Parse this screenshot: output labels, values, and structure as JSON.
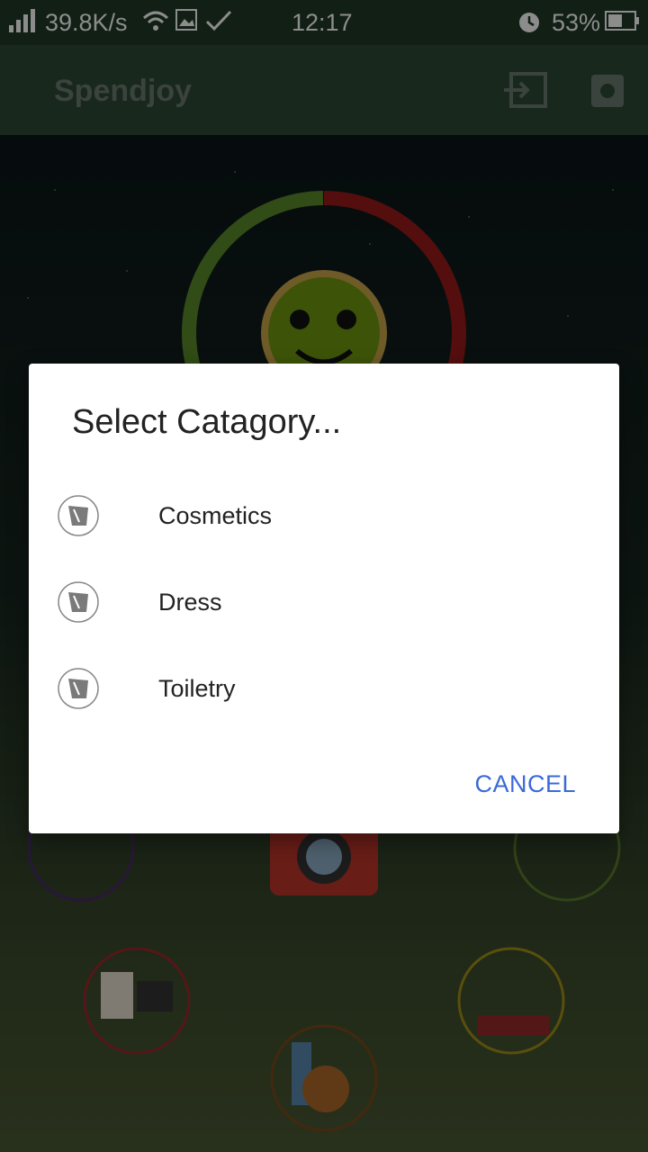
{
  "status_bar": {
    "speed": "39.8K/s",
    "time": "12:17",
    "battery": "53%"
  },
  "app_bar": {
    "title": "Spendjoy",
    "icons": [
      "login-icon",
      "gear-icon"
    ]
  },
  "dialog": {
    "title": "Select Catagory...",
    "items": [
      {
        "label": "Cosmetics",
        "icon": "category-icon"
      },
      {
        "label": "Dress",
        "icon": "category-icon"
      },
      {
        "label": "Toiletry",
        "icon": "category-icon"
      }
    ],
    "cancel_label": "CANCEL"
  },
  "colors": {
    "accent": "#3a6ad8",
    "appbar": "#2f4a36",
    "statusbar": "#1f3a27",
    "gauge_green": "#5a8a2a",
    "gauge_red": "#9a1a18",
    "gauge_orange": "#c0701a"
  }
}
